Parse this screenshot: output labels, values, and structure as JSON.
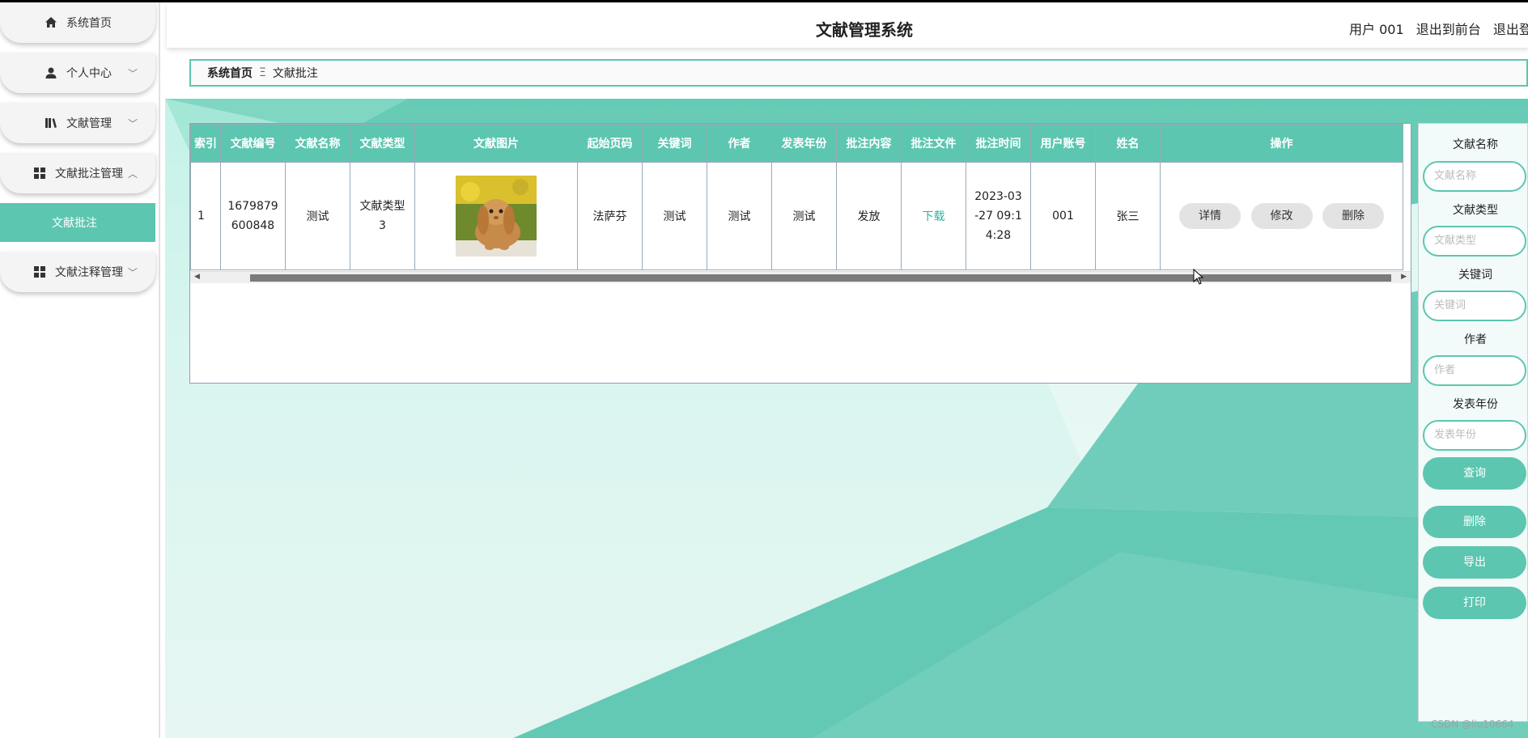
{
  "sidebar": {
    "items": [
      {
        "label": "系统首页",
        "icon": "home-icon"
      },
      {
        "label": "个人中心",
        "icon": "user-icon"
      },
      {
        "label": "文献管理",
        "icon": "books-icon"
      },
      {
        "label": "文献批注管理",
        "icon": "grid-icon"
      },
      {
        "label": "文献注释管理",
        "icon": "grid-icon"
      }
    ],
    "submenu_active": "文献批注"
  },
  "header": {
    "title": "文献管理系统",
    "user": "用户 001",
    "to_front": "退出到前台",
    "logout": "退出登录"
  },
  "breadcrumb": {
    "home": "系统首页",
    "separator": "Ξ",
    "current": "文献批注"
  },
  "table": {
    "columns": [
      "索引",
      "文献编号",
      "文献名称",
      "文献类型",
      "文献图片",
      "起始页码",
      "关键词",
      "作者",
      "发表年份",
      "批注内容",
      "批注文件",
      "批注时间",
      "用户账号",
      "姓名",
      "操作"
    ],
    "rows": [
      {
        "index": "1",
        "doc_no": "1679879600848",
        "doc_name": "测试",
        "doc_type": "文献类型3",
        "start_page": "法萨芬",
        "keywords": "测试",
        "author": "测试",
        "year": "测试",
        "annotation": "发放",
        "file_link": "下载",
        "time": "2023-03-27 09:14:28",
        "account": "001",
        "name": "张三",
        "actions": {
          "detail": "详情",
          "edit": "修改",
          "delete": "删除"
        }
      }
    ]
  },
  "search_panel": {
    "fields": [
      {
        "label": "文献名称",
        "placeholder": "文献名称"
      },
      {
        "label": "文献类型",
        "placeholder": "文献类型"
      },
      {
        "label": "关键词",
        "placeholder": "关键词"
      },
      {
        "label": "作者",
        "placeholder": "作者"
      },
      {
        "label": "发表年份",
        "placeholder": "发表年份"
      }
    ],
    "query": "查询",
    "delete": "删除",
    "export": "导出",
    "print": "打印"
  },
  "watermark": "CSDN @liu10664",
  "colors": {
    "accent": "#5cc6b0",
    "accent_dark": "#2bb39a"
  }
}
